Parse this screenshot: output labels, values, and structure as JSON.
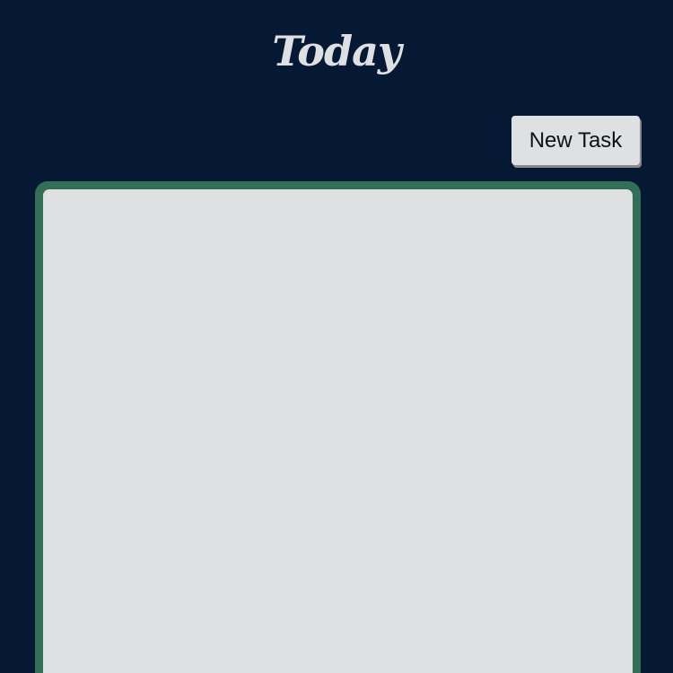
{
  "header": {
    "title": "Today"
  },
  "toolbar": {
    "new_task_label": "New Task"
  },
  "task_list": {
    "items": []
  },
  "colors": {
    "background": "#051935",
    "panel_border": "#336e56",
    "panel_fill": "#dfe0e2",
    "title_text": "#dfe0e2"
  }
}
